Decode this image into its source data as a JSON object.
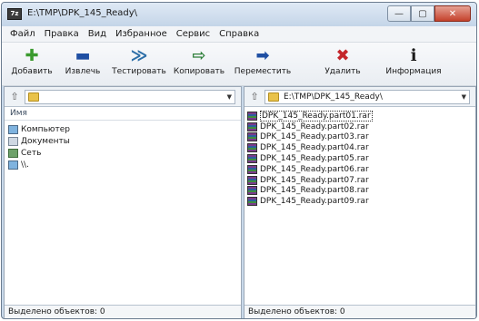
{
  "window": {
    "title": "E:\\TMP\\DPK_145_Ready\\",
    "app_icon_text": "7z",
    "minimize_glyph": "—",
    "maximize_glyph": "▢",
    "close_glyph": "✕"
  },
  "menu": [
    "Файл",
    "Правка",
    "Вид",
    "Избранное",
    "Сервис",
    "Справка"
  ],
  "toolbar": {
    "add": {
      "label": "Добавить",
      "glyph": "✚",
      "color": "#3a9a2e"
    },
    "extract": {
      "label": "Извлечь",
      "glyph": "▬",
      "color": "#1f4fa3"
    },
    "test": {
      "label": "Тестировать",
      "glyph": "≫",
      "color": "#2d6fa8"
    },
    "copy": {
      "label": "Копировать",
      "glyph": "⇨",
      "color": "#2e7f3a"
    },
    "move": {
      "label": "Переместить",
      "glyph": "➡",
      "color": "#1f4fa3"
    },
    "delete": {
      "label": "Удалить",
      "glyph": "✖",
      "color": "#c4262b"
    },
    "info": {
      "label": "Информация",
      "glyph": "ℹ",
      "color": "#1a1a1a"
    }
  },
  "left_pane": {
    "path": "",
    "column_name": "Имя",
    "items": [
      {
        "name": "Компьютер",
        "icon": "computer-icon"
      },
      {
        "name": "Документы",
        "icon": "documents-icon"
      },
      {
        "name": "Сеть",
        "icon": "network-icon"
      },
      {
        "name": "\\\\.",
        "icon": "drive-icon"
      }
    ],
    "status": "Выделено объектов: 0"
  },
  "right_pane": {
    "path": "E:\\TMP\\DPK_145_Ready\\",
    "items": [
      {
        "name": "DPK_145_Ready.part01.rar",
        "selected": true
      },
      {
        "name": "DPK_145_Ready.part02.rar"
      },
      {
        "name": "DPK_145_Ready.part03.rar"
      },
      {
        "name": "DPK_145_Ready.part04.rar"
      },
      {
        "name": "DPK_145_Ready.part05.rar"
      },
      {
        "name": "DPK_145_Ready.part06.rar"
      },
      {
        "name": "DPK_145_Ready.part07.rar"
      },
      {
        "name": "DPK_145_Ready.part08.rar"
      },
      {
        "name": "DPK_145_Ready.part09.rar"
      }
    ],
    "status": "Выделено объектов: 0"
  }
}
